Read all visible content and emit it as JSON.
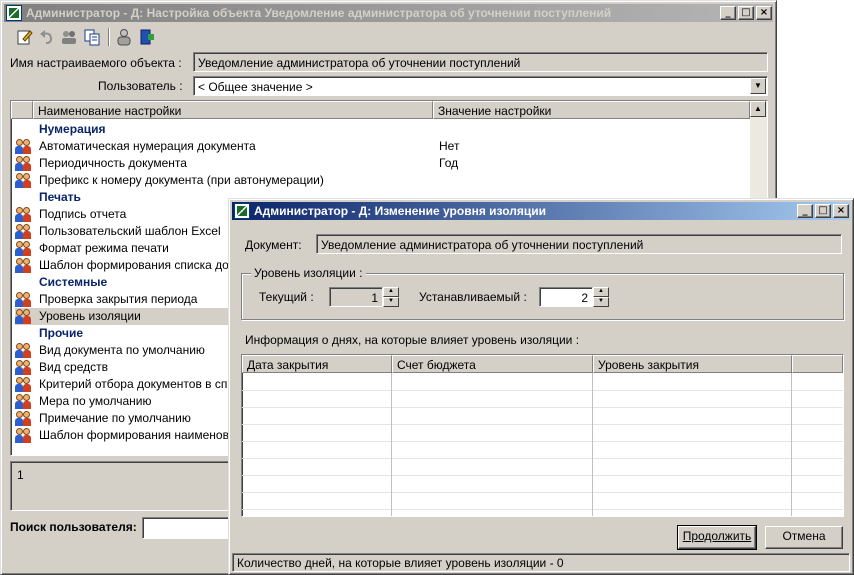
{
  "main": {
    "title": "Администратор - Д: Настройка объекта Уведомление администратора об уточнении поступлений",
    "object_label": "Имя настраиваемого объекта :",
    "object_value": "Уведомление администратора об уточнении поступлений",
    "user_label": "Пользователь :",
    "user_value": "< Общее значение >",
    "columns": [
      "Наименование настройки",
      "Значение настройки"
    ],
    "groups": {
      "numbering": "Нумерация",
      "print": "Печать",
      "system": "Системные",
      "other": "Прочие"
    },
    "rows": [
      {
        "name": "Автоматическая нумерация документа",
        "value": "Нет"
      },
      {
        "name": "Периодичность документа",
        "value": "Год"
      },
      {
        "name": "Префикс к номеру документа (при автонумерации)",
        "value": ""
      },
      {
        "name": "Подпись отчета",
        "value": ""
      },
      {
        "name": "Пользовательский шаблон Excel",
        "value": ""
      },
      {
        "name": "Формат режима печати",
        "value": ""
      },
      {
        "name": "Шаблон формирования списка до",
        "value": ""
      },
      {
        "name": "Проверка закрытия периода",
        "value": ""
      },
      {
        "name": "Уровень изоляции",
        "value": ""
      },
      {
        "name": "Вид документа по умолчанию",
        "value": ""
      },
      {
        "name": "Вид средств",
        "value": ""
      },
      {
        "name": "Критерий отбора документов в сп",
        "value": ""
      },
      {
        "name": "Мера по умолчанию",
        "value": ""
      },
      {
        "name": "Примечание по умолчанию",
        "value": ""
      },
      {
        "name": "Шаблон формирования наименов",
        "value": ""
      }
    ],
    "description_text": "1",
    "search_label": "Поиск пользователя:"
  },
  "dialog": {
    "title": "Администратор - Д: Изменение уровня изоляции",
    "document_label": "Документ:",
    "document_value": "Уведомление администратора об уточнении поступлений",
    "group_label": "Уровень изоляции :",
    "current_label": "Текущий :",
    "current_value": "1",
    "new_label": "Устанавливаемый :",
    "new_value": "2",
    "info_label": "Информация о днях, на которые влияет уровень изоляции :",
    "columns": [
      "Дата закрытия",
      "Счет бюджета",
      "Уровень закрытия"
    ],
    "continue_button": "Продолжить",
    "cancel_button": "Отмена",
    "status": "Количество дней, на которые влияет уровень изоляции - 0"
  }
}
